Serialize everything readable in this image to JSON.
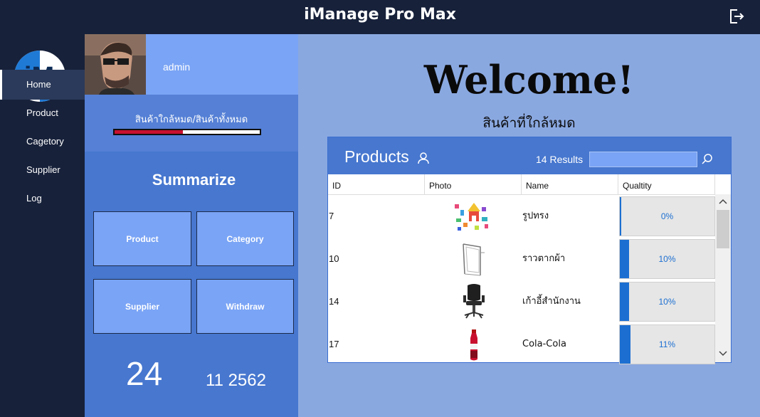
{
  "app": {
    "title": "iManage Pro Max"
  },
  "logo": {
    "text": "iM"
  },
  "sidebar": {
    "items": [
      {
        "label": "Home",
        "active": true
      },
      {
        "label": "Product"
      },
      {
        "label": "Cagetory"
      },
      {
        "label": "Supplier"
      },
      {
        "label": "Log"
      }
    ]
  },
  "profile": {
    "username": "admin"
  },
  "stock": {
    "label": "สินค้าใกล้หมด/สินค้าทั้งหมด",
    "ratio": 0.47
  },
  "summary": {
    "title": "Summarize",
    "buttons": [
      "Product",
      "Category",
      "Supplier",
      "Withdraw"
    ]
  },
  "date": {
    "day": "24",
    "rest": "11 2562"
  },
  "main": {
    "welcome": "Welcome!",
    "subtitle": "สินค้าที่ใกล้หมด"
  },
  "products": {
    "title": "Products",
    "results": "14 Results",
    "search_value": "",
    "columns": [
      "ID",
      "Photo",
      "Name",
      "Qualtity"
    ],
    "rows": [
      {
        "id": "7",
        "name": "รูปทรง",
        "quantity": "0%",
        "quantity_fraction": 0.0,
        "photo": "colorful-shapes"
      },
      {
        "id": "10",
        "name": "ราวตากผ้า",
        "quantity": "10%",
        "quantity_fraction": 0.1,
        "photo": "clothes-rack"
      },
      {
        "id": "14",
        "name": "เก้าอี้สำนักงาน",
        "quantity": "10%",
        "quantity_fraction": 0.1,
        "photo": "office-chair"
      },
      {
        "id": "17",
        "name": "Cola-Cola",
        "quantity": "11%",
        "quantity_fraction": 0.11,
        "photo": "cola-bottle"
      }
    ]
  },
  "colors": {
    "dark_bg": "#17213a",
    "panel_blue": "#4777cf",
    "light_blue": "#7aa4f5",
    "main_bg": "#8aa8e0",
    "progress_red": "#c8102e",
    "accent_blue": "#1c6fd1"
  }
}
